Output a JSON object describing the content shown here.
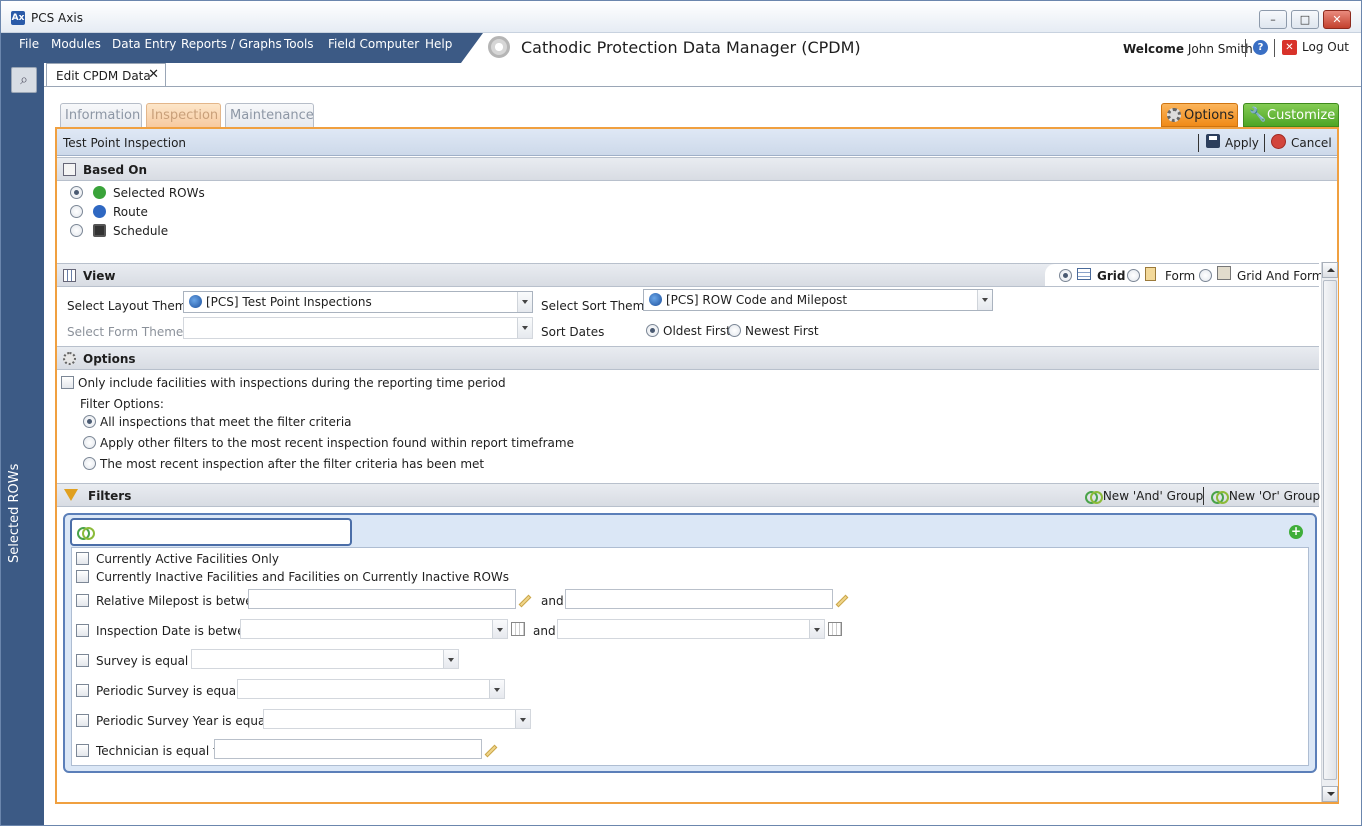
{
  "window": {
    "title": "PCS Axis",
    "icon_label": "Ax"
  },
  "menu": [
    "File",
    "Modules",
    "Data Entry",
    "Reports / Graphs",
    "Tools",
    "Field Computer",
    "Help"
  ],
  "header": {
    "app_title": "Cathodic Protection Data Manager (CPDM)",
    "welcome_label": "Welcome",
    "user_name": "John Smith",
    "logout_label": "Log Out"
  },
  "sidebar": {
    "label": "Selected ROWs"
  },
  "doc_tab": {
    "label": "Edit CPDM Data"
  },
  "subtabs": [
    "Information",
    "Inspection",
    "Maintenance"
  ],
  "buttons": {
    "options": "Options",
    "customize": "Customize",
    "apply": "Apply",
    "cancel": "Cancel"
  },
  "panel_title": "Test Point Inspection",
  "based_on": {
    "title": "Based On",
    "options": [
      "Selected ROWs",
      "Route",
      "Schedule"
    ],
    "selected": "Selected ROWs"
  },
  "view": {
    "title": "View",
    "modes": [
      "Grid",
      "Form",
      "Grid And Form"
    ],
    "selected_mode": "Grid",
    "layout_theme_label": "Select Layout Theme",
    "layout_theme_value": "[PCS] Test Point Inspections",
    "form_theme_label": "Select Form Theme",
    "form_theme_value": "",
    "sort_theme_label": "Select Sort Theme",
    "sort_theme_value": "[PCS] ROW Code and Milepost",
    "sort_dates_label": "Sort Dates",
    "sort_dates_options": [
      "Oldest First",
      "Newest First"
    ],
    "sort_dates_selected": "Oldest First"
  },
  "options": {
    "title": "Options",
    "only_include_label": "Only include facilities with inspections during the reporting time period",
    "filter_options_label": "Filter Options:",
    "filter_choices": [
      "All inspections that meet the filter criteria",
      "Apply other filters to the most recent inspection found within report timeframe",
      "The most recent inspection after the filter criteria has been met"
    ],
    "filter_choice_selected": 0
  },
  "filters": {
    "title": "Filters",
    "new_and": "New 'And' Group",
    "new_or": "New 'Or' Group",
    "group_name": "",
    "active_only": "Currently Active Facilities Only",
    "inactive": "Currently Inactive Facilities and Facilities on Currently Inactive ROWs",
    "milepost": "Relative Milepost is between",
    "and_label": "and",
    "inspection_date": "Inspection Date is between",
    "survey": "Survey is equal to",
    "periodic_survey": "Periodic Survey is equal to",
    "periodic_survey_year": "Periodic Survey Year is equal to",
    "technician": "Technician is equal to"
  },
  "colors": {
    "menu_blue": "#3c5a85",
    "options_orange": "#f08a17",
    "customize_green": "#4ea525",
    "panel_border": "#f0a040"
  }
}
